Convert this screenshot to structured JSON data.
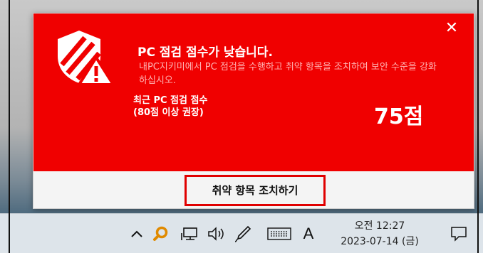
{
  "popup": {
    "close_glyph": "✕",
    "title": "PC 점검 점수가 낮습니다.",
    "description": "내PC지키미에서 PC 점검을 수행하고 취약 항목을 조치하여 보안 수준을 강화하십시오.",
    "score_label_line1": "최근 PC 점검 점수",
    "score_label_line2": "(80점 이상 권장)",
    "score_value": "75점",
    "action_button": "취약 항목 조치하기",
    "colors": {
      "banner": "#f00000",
      "highlight_border": "#e00000"
    }
  },
  "taskbar": {
    "chevron_glyph": "^",
    "ime_label": "A",
    "clock_time": "오전 12:27",
    "clock_date": "2023-07-14 (금)",
    "icons": [
      "chevron-up-icon",
      "magnifier-icon",
      "network-icon",
      "volume-icon",
      "pen-icon",
      "keyboard-icon",
      "notification-icon"
    ]
  }
}
